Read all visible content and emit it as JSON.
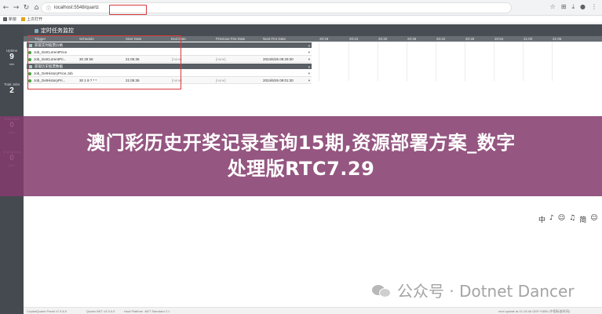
{
  "browser": {
    "url": "localhost:5548/quartz",
    "bookmarks": [
      "新窗",
      "上次打开"
    ]
  },
  "sidebar": {
    "stats": [
      {
        "label": "Uptime",
        "value": "9",
        "unit": "min"
      },
      {
        "label": "Total Jobs",
        "value": "2",
        "unit": ""
      },
      {
        "label": "Executed",
        "value": "0",
        "unit": "jobs"
      },
      {
        "label": "In progress",
        "value": "0",
        "unit": "jobs"
      }
    ]
  },
  "app": {
    "title": "定时任务监控"
  },
  "table": {
    "columns": [
      "Trigger",
      "Schedule",
      "Start Date",
      "End Date",
      "Previous Fire Date",
      "Next Fire Date"
    ],
    "timeline": [
      "20:18",
      "20:24",
      "20:30",
      "20:36",
      "20:42",
      "20:48",
      "20:54",
      "21:00",
      "21:06"
    ],
    "groups": [
      {
        "name": "获取实时股票价格",
        "jobs": [
          {
            "trigger": "Job_GetCurrentPrice",
            "schedule": "",
            "start": "",
            "end": "",
            "prev": "",
            "next": ""
          },
          {
            "trigger": "Job_GetCurrentPri...",
            "schedule": "30 29 59",
            "start": "21:05:36",
            "end": "[none]",
            "prev": "[none]",
            "next": "2024/6/26 09:29:30"
          }
        ]
      },
      {
        "name": "获取历史股票数据",
        "jobs": [
          {
            "trigger": "Job_GetHistoryPrice.Job",
            "schedule": "",
            "start": "",
            "end": "",
            "prev": "",
            "next": ""
          },
          {
            "trigger": "Job_GetHistoryPri...",
            "schedule": "30 1 9 ? * *",
            "start": "21:05:36",
            "end": "[none]",
            "prev": "[none]",
            "next": "2024/6/26 09:01:30"
          }
        ]
      }
    ]
  },
  "banner": {
    "line1": "澳门彩历史开奖记录查询15期,资源部署方案_数字",
    "line2": "处理版RTC7.29"
  },
  "watermark": {
    "text": "公众号 · Dotnet Dancer"
  },
  "mini_toolbar": [
    "中",
    "♪",
    "☺",
    "♫",
    "简",
    "☺",
    "⚙"
  ],
  "footer": {
    "panel": "CrystalQuartz Panel v7.5.6.0",
    "quartz": "Quartz.NET v3.9.0.0",
    "platform": "Host Platform .NET Standard 2.1",
    "update": "next update at 21:15:46 GMT+0800 (中国标准时间)"
  }
}
